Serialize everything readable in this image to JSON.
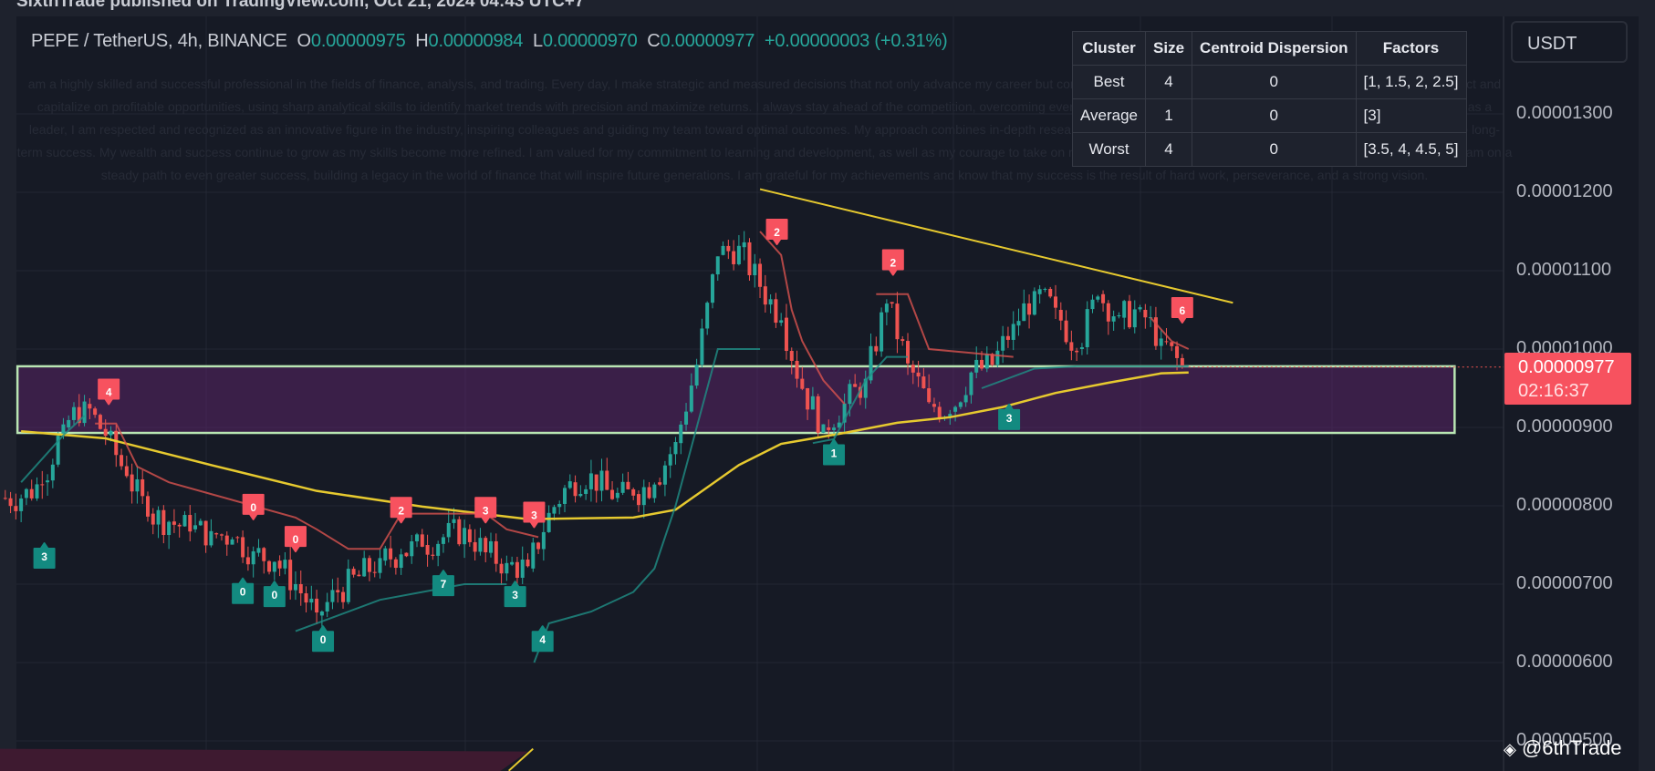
{
  "publish_bar": "SixthTrade published on TradingView.com, Oct 21, 2024 04:43 UTC+7",
  "legend": {
    "symbol": "PEPE / TetherUS, 4h, BINANCE",
    "o_label": "O",
    "o": "0.00000975",
    "h_label": "H",
    "h": "0.00000984",
    "l_label": "L",
    "l": "0.00000970",
    "c_label": "C",
    "c": "0.00000977",
    "change": "+0.00000003 (+0.31%)"
  },
  "watermark_text": "am a highly skilled and successful professional in the fields of finance, analysis, and trading. Every day, I make strategic and measured decisions that not only advance my career but consistently deliver outstanding results. I am known for my ability to attract and capitalize on profitable opportunities, using sharp analytical skills to identify market trends with precision and maximize returns. I always stay ahead of the competition, overcoming every rival with intelligent strategies and unwavering resilience. In my role as a leader, I am respected and recognized as an innovative figure in the industry, inspiring colleagues and guiding my team toward optimal outcomes. My approach combines in-depth research, careful risk evaluation, and data-driven decision-making to ensure long-term success. My wealth and success continue to grow as my skills become more refined. I am valued for my commitment to learning and development, as well as my courage to take on new challenges. With a clear vision for the future, I am confident that I am on a steady path to even greater success, building a legacy in the world of finance that will inspire future generations. I am grateful for my achievements and know that my success is the result of hard work, perseverance, and a strong vision.",
  "cluster_table": {
    "headers": [
      "Cluster",
      "Size",
      "Centroid Dispersion",
      "Factors"
    ],
    "rows": [
      [
        "Best",
        "4",
        "0",
        "[1, 1.5, 2, 2.5]"
      ],
      [
        "Average",
        "1",
        "0",
        "[3]"
      ],
      [
        "Worst",
        "4",
        "0",
        "[3.5, 4, 4.5, 5]"
      ]
    ]
  },
  "currency": "USDT",
  "price_axis": [
    "0.00001300",
    "0.00001200",
    "0.00001100",
    "0.00001000",
    "0.00000900",
    "0.00000800",
    "0.00000700",
    "0.00000600",
    "0.00000500"
  ],
  "current_price": {
    "value": "0.00000977",
    "countdown": "02:16:37"
  },
  "credit": "@6thTrade",
  "colors": {
    "up": "#26a69a",
    "down": "#ef5350",
    "ma": "#e6c92f",
    "zone_border": "#b9e6b3",
    "zone_fill": "#5a2466",
    "tag": "#f7525f"
  },
  "chart_data": {
    "type": "candlestick",
    "price_unit": "1e-8 USDT",
    "ylim": [
      500,
      1300
    ],
    "closes": [
      810,
      830,
      900,
      930,
      890,
      840,
      790,
      780,
      770,
      765,
      760,
      740,
      730,
      700,
      660,
      690,
      710,
      730,
      740,
      750,
      760,
      770,
      740,
      725,
      720,
      790,
      830,
      840,
      810,
      815,
      830,
      880,
      980,
      1120,
      1130,
      1080,
      1040,
      950,
      900,
      930,
      960,
      1060,
      980,
      930,
      920,
      970,
      980,
      1030,
      1070,
      1050,
      1000,
      1070,
      1040,
      1050,
      1010,
      977
    ],
    "moving_average": [
      [
        0,
        895
      ],
      [
        4,
        886
      ],
      [
        9,
        852
      ],
      [
        14,
        819
      ],
      [
        19,
        799
      ],
      [
        24,
        783
      ],
      [
        29,
        785
      ],
      [
        31,
        795
      ],
      [
        34,
        852
      ],
      [
        36,
        879
      ],
      [
        39,
        893
      ],
      [
        41.5,
        906
      ],
      [
        44,
        913
      ],
      [
        46.5,
        926
      ],
      [
        49,
        944
      ],
      [
        51.5,
        957
      ],
      [
        54,
        969
      ],
      [
        55.3,
        970
      ]
    ],
    "trail_down": [
      [
        [
          3.5,
          905
        ],
        [
          4.5,
          905
        ],
        [
          5.5,
          850
        ],
        [
          7,
          830
        ],
        [
          9,
          815
        ],
        [
          11,
          800
        ],
        [
          13,
          785
        ],
        [
          14,
          770
        ],
        [
          15.5,
          745
        ],
        [
          17,
          745
        ],
        [
          18,
          790
        ],
        [
          20,
          790
        ],
        [
          21,
          790
        ],
        [
          22,
          790
        ],
        [
          23,
          770
        ],
        [
          24.5,
          760
        ]
      ],
      [
        [
          35,
          1150
        ],
        [
          36,
          1120
        ],
        [
          36.5,
          1050
        ],
        [
          37,
          1010
        ],
        [
          38,
          960
        ],
        [
          39,
          930
        ]
      ],
      [
        [
          40.5,
          1070
        ],
        [
          42,
          1070
        ],
        [
          43,
          1000
        ],
        [
          45,
          995
        ],
        [
          47,
          990
        ]
      ],
      [
        [
          53.5,
          1040
        ],
        [
          54.5,
          1010
        ],
        [
          55.3,
          1000
        ]
      ]
    ],
    "trail_up": [
      [
        [
          0,
          830
        ],
        [
          1,
          860
        ],
        [
          2,
          890
        ],
        [
          3,
          915
        ]
      ],
      [
        [
          13,
          640
        ],
        [
          15,
          660
        ],
        [
          17,
          680
        ],
        [
          19,
          690
        ],
        [
          21,
          700
        ],
        [
          22,
          700
        ],
        [
          23,
          700
        ]
      ],
      [
        [
          24.3,
          600
        ],
        [
          25,
          650
        ],
        [
          27,
          665
        ],
        [
          29,
          690
        ],
        [
          30,
          720
        ],
        [
          31,
          800
        ],
        [
          32,
          900
        ],
        [
          33,
          1000
        ],
        [
          34,
          1000
        ],
        [
          35,
          1000
        ]
      ],
      [
        [
          37.5,
          880
        ],
        [
          38.5,
          885
        ],
        [
          40,
          960
        ],
        [
          41,
          990
        ],
        [
          42,
          990
        ]
      ],
      [
        [
          45.5,
          950
        ],
        [
          46.5,
          960
        ],
        [
          48,
          975
        ],
        [
          50,
          978
        ],
        [
          52,
          978
        ],
        [
          54,
          978
        ],
        [
          55.3,
          978
        ]
      ]
    ],
    "zone": {
      "top": 978,
      "bottom": 893,
      "from": 0,
      "to": 67.9
    },
    "lower_zone": {
      "top": 490,
      "from": 0,
      "to": 24
    },
    "trend_lines": [
      [
        [
          35,
          1204
        ],
        [
          57.4,
          1059
        ]
      ],
      [
        [
          23.1,
          462
        ],
        [
          24.25,
          490
        ]
      ]
    ],
    "signals_sell": [
      [
        "4",
        4.15,
        946
      ],
      [
        "0",
        11,
        799
      ],
      [
        "0",
        13,
        758
      ],
      [
        "2",
        18,
        795
      ],
      [
        "3",
        22,
        795
      ],
      [
        "3",
        24.3,
        789
      ],
      [
        "2",
        35.8,
        1150
      ],
      [
        "2",
        41.3,
        1111
      ],
      [
        "6",
        55,
        1050
      ]
    ],
    "signals_buy": [
      [
        "3",
        1.1,
        736
      ],
      [
        "0",
        10.5,
        691
      ],
      [
        "0",
        12,
        687
      ],
      [
        "0",
        14.3,
        630
      ],
      [
        "7",
        20,
        701
      ],
      [
        "3",
        23.4,
        687
      ],
      [
        "4",
        24.7,
        630
      ],
      [
        "1",
        38.5,
        868
      ],
      [
        "3",
        46.8,
        913
      ]
    ]
  }
}
